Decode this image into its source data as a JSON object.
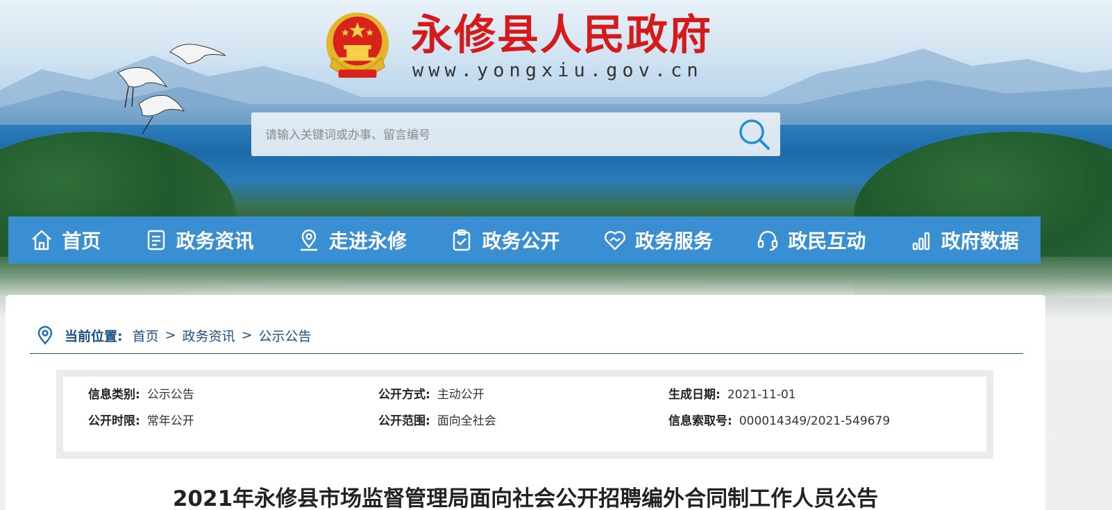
{
  "header": {
    "site_title": "永修县人民政府",
    "site_url": "www.yongxiu.gov.cn",
    "emblem_icon": "national-emblem-icon"
  },
  "search": {
    "placeholder": "请输入关键词或办事、留言编号",
    "value": "",
    "icon": "search-icon"
  },
  "nav": {
    "items": [
      {
        "label": "首页",
        "icon": "home-icon"
      },
      {
        "label": "政务资讯",
        "icon": "document-icon"
      },
      {
        "label": "走进永修",
        "icon": "location-pin-icon"
      },
      {
        "label": "政务公开",
        "icon": "clipboard-check-icon"
      },
      {
        "label": "政务服务",
        "icon": "handshake-heart-icon"
      },
      {
        "label": "政民互动",
        "icon": "headset-icon"
      },
      {
        "label": "政府数据",
        "icon": "bar-chart-icon"
      }
    ]
  },
  "breadcrumb": {
    "lead": "当前位置:",
    "items": [
      "首页",
      "政务资讯",
      "公示公告"
    ],
    "separator": ">"
  },
  "meta": {
    "category_label": "信息类别:",
    "category_value": "公示公告",
    "method_label": "公开方式:",
    "method_value": "主动公开",
    "date_label": "生成日期:",
    "date_value": "2021-11-01",
    "period_label": "公开时限:",
    "period_value": "常年公开",
    "scope_label": "公开范围:",
    "scope_value": "面向全社会",
    "index_label": "信息索取号:",
    "index_value": "000014349/2021-549679"
  },
  "article": {
    "title": "2021年永修县市场监督管理局面向社会公开招聘编外合同制工作人员公告"
  },
  "colors": {
    "nav_bg": "#3a8fd3",
    "title_red": "#d41a1a",
    "breadcrumb_blue": "#1b4f8a"
  }
}
